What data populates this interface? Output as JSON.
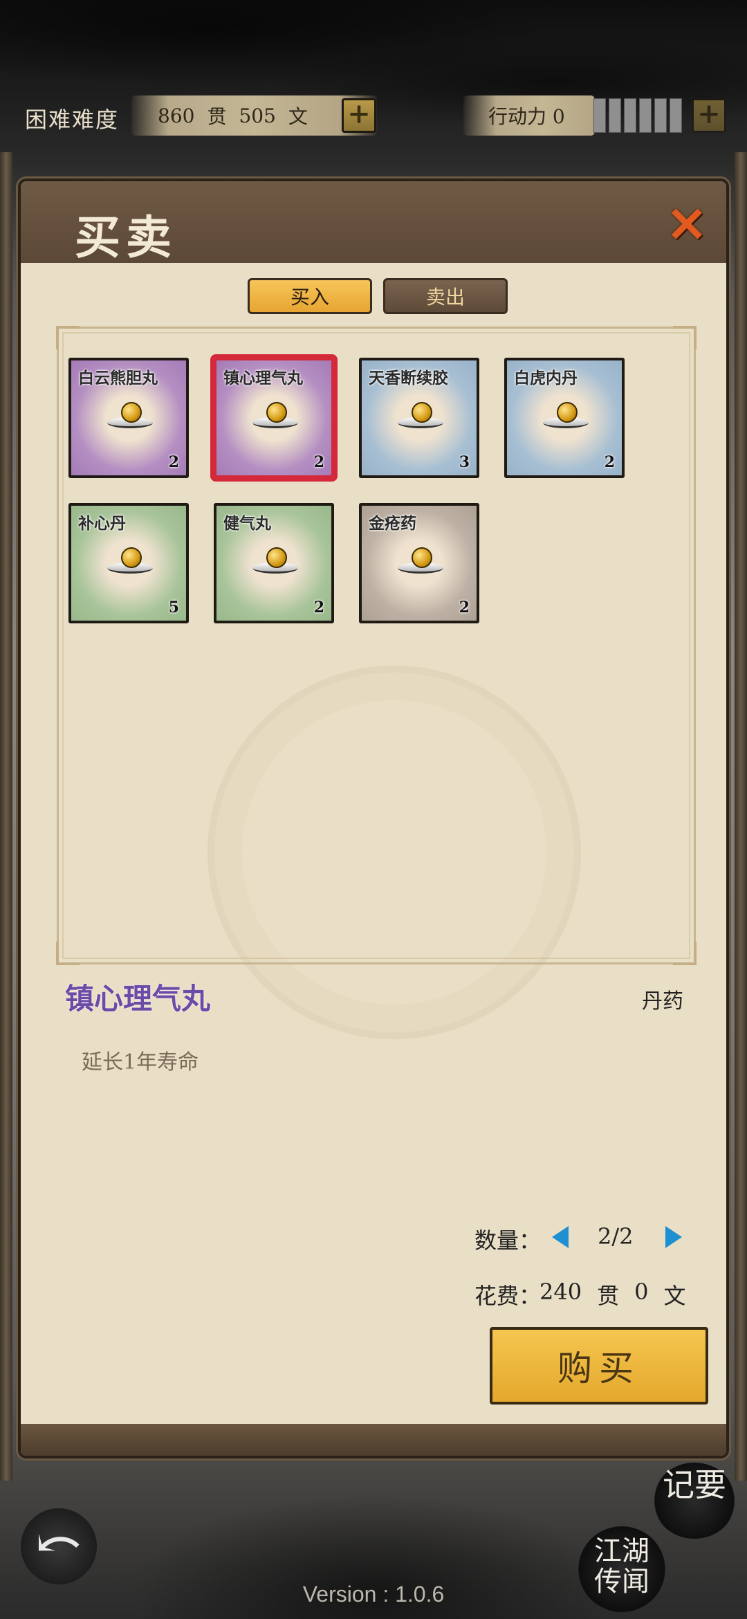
{
  "topbar": {
    "difficulty": "困难难度",
    "money_guan": "860",
    "guan_unit": "贯",
    "money_wen": "505",
    "wen_unit": "文",
    "stamina": "行动力 0",
    "stamina_level": 0
  },
  "panel": {
    "title": "买卖",
    "tabs": {
      "buy": "买入",
      "sell": "卖出",
      "active": "buy"
    },
    "items": [
      {
        "name": "白云熊胆丸",
        "count": "2",
        "color": "purple"
      },
      {
        "name": "镇心理气丸",
        "count": "2",
        "color": "purple",
        "selected": true
      },
      {
        "name": "天香断续胶",
        "count": "3",
        "color": "blue"
      },
      {
        "name": "白虎内丹",
        "count": "2",
        "color": "blue"
      },
      {
        "name": "补心丹",
        "count": "5",
        "color": "green"
      },
      {
        "name": "健气丸",
        "count": "2",
        "color": "green"
      },
      {
        "name": "金疮药",
        "count": "2",
        "color": "gray"
      }
    ],
    "detail": {
      "name": "镇心理气丸",
      "type": "丹药",
      "description": "延长1年寿命"
    },
    "quantity": {
      "label": "数量：",
      "value": "2/2"
    },
    "cost": {
      "label": "花费：",
      "guan": "240",
      "guan_unit": "贯",
      "wen": "0",
      "wen_unit": "文"
    },
    "buy_button": "购买"
  },
  "bottom": {
    "memo_button": "记要",
    "news_button_line1": "江湖",
    "news_button_line2": "传闻",
    "version": "Version : 1.0.6"
  },
  "colors": {
    "tab_active": "#f5c650",
    "selected_border": "#d4293a",
    "detail_name": "#6b4aa8",
    "arrow": "#1e8fd0"
  }
}
